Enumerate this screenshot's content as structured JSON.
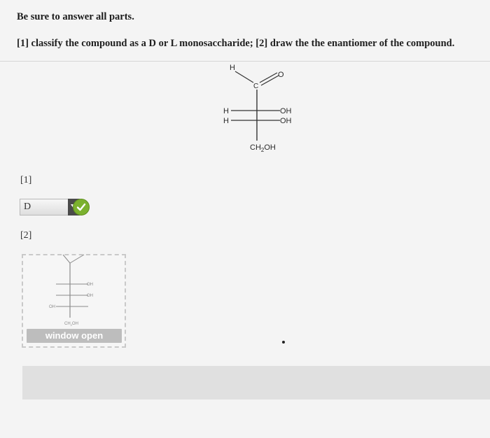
{
  "instructions": "Be sure to answer all parts.",
  "question": "[1] classify the compound as a D or L monosaccharide; [2] draw the the enantiomer of the compound.",
  "molecule": {
    "top_h": "H",
    "carbon": "C",
    "oxygen": "O",
    "row1_left": "H",
    "row1_right": "OH",
    "row2_left": "H",
    "row2_right": "OH",
    "bottom_group": "CH2OH",
    "bottom_main": "CH",
    "bottom_sub": "2",
    "bottom_tail": "OH"
  },
  "part1": {
    "label": "[1]",
    "selected_value": "D",
    "status": "correct",
    "status_color": "#7bb12e"
  },
  "part2": {
    "label": "[2]",
    "thumbnail": {
      "left_group": "OH",
      "right_group_1": "OH",
      "right_group_2": "OH",
      "bottom": "CH2OH",
      "bottom_main": "CH",
      "bottom_sub": "2",
      "bottom_tail": "OH"
    },
    "window_button": "window open"
  }
}
